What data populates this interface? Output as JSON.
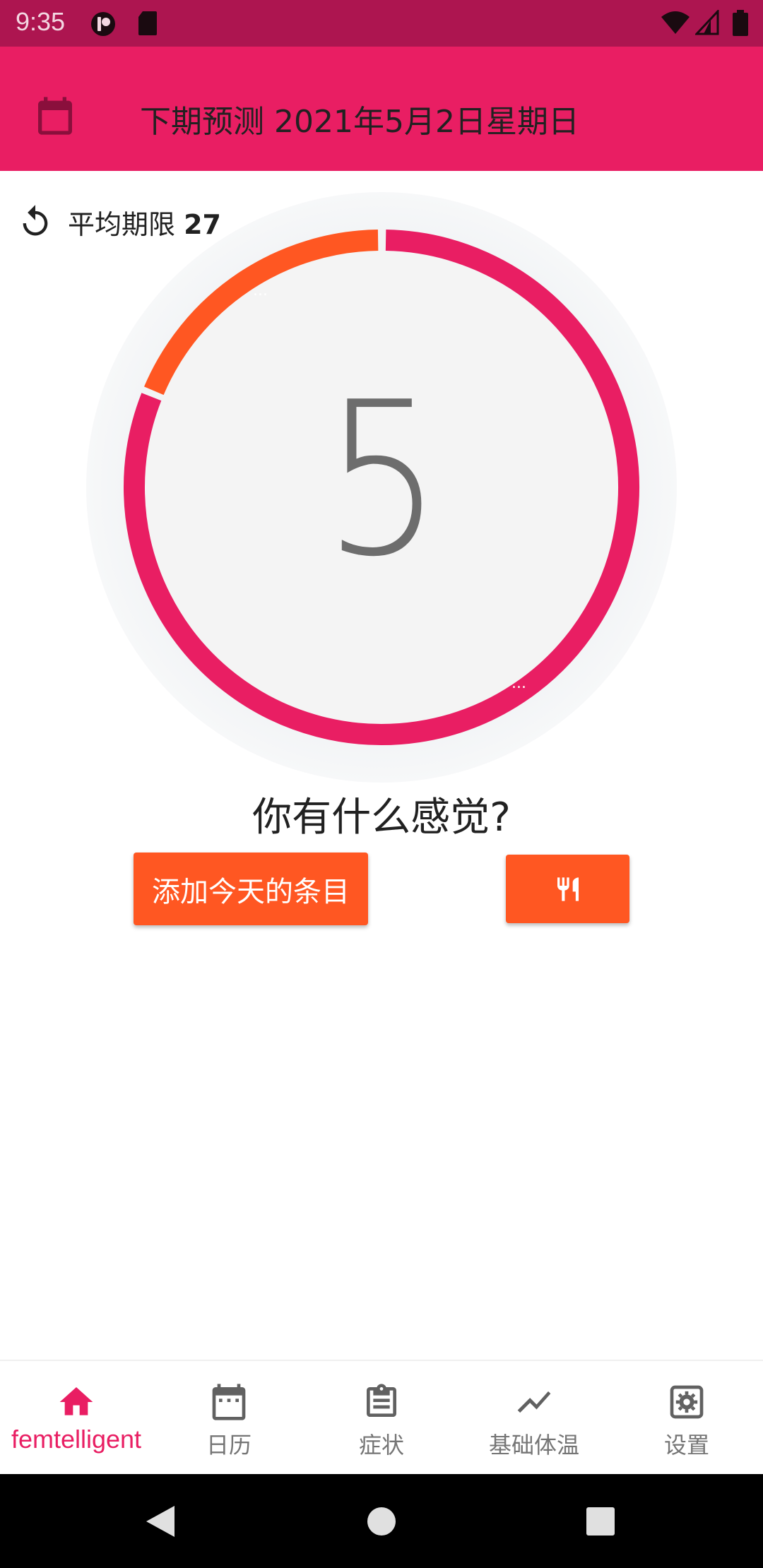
{
  "status_bar": {
    "time": "9:35",
    "icons": [
      "notification-app-icon",
      "sd-card-icon",
      "wifi-icon",
      "signal-icon",
      "battery-icon"
    ]
  },
  "app_bar": {
    "calendar_icon": "calendar-icon",
    "title": "下期预测 2021年5月2日星期日"
  },
  "cycle": {
    "average_label": "平均期限",
    "average_value": "27",
    "current_day": "5",
    "dots_marker": "...",
    "segments": {
      "fertile_color": "#ff5722",
      "period_color": "#e91e63"
    }
  },
  "question": "你有什么感觉?",
  "buttons": {
    "add_entry": "添加今天的条目",
    "food_icon": "fork-knife-icon"
  },
  "bottom_nav": {
    "items": [
      {
        "label": "femtelligent",
        "icon": "home-icon",
        "active": true
      },
      {
        "label": "日历",
        "icon": "calendar-icon",
        "active": false
      },
      {
        "label": "症状",
        "icon": "clipboard-icon",
        "active": false
      },
      {
        "label": "基础体温",
        "icon": "trending-line-icon",
        "active": false
      },
      {
        "label": "设置",
        "icon": "settings-icon",
        "active": false
      }
    ]
  },
  "colors": {
    "status_bar": "#ad1550",
    "app_bar": "#e91e63",
    "accent": "#ff5722",
    "nav_active": "#e91e63"
  }
}
